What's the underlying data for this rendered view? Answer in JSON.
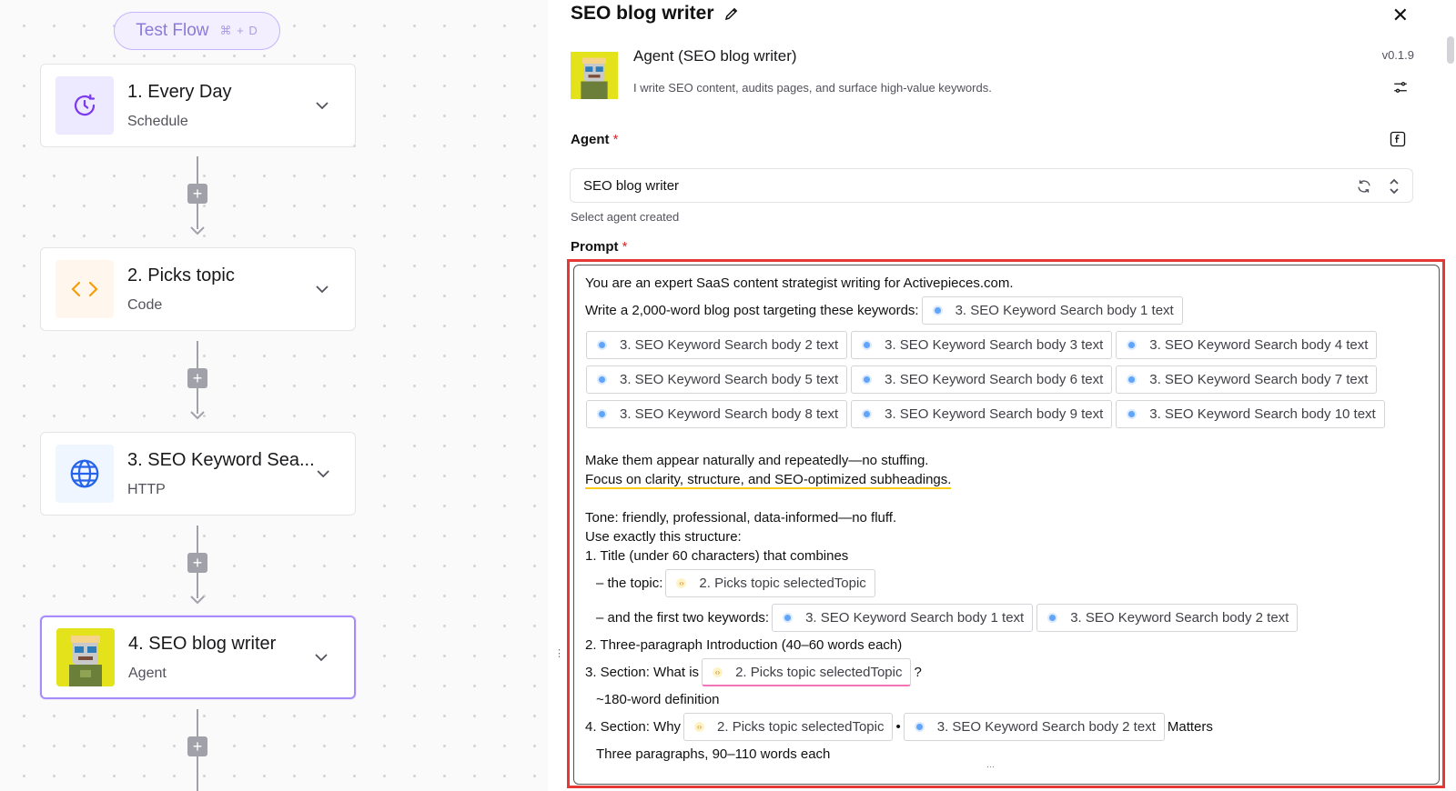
{
  "canvas": {
    "test_flow": {
      "label": "Test Flow",
      "shortcut": "⌘ + D"
    },
    "steps": [
      {
        "title": "1. Every Day",
        "subtitle": "Schedule",
        "icon": "clock-icon"
      },
      {
        "title": "2. Picks topic",
        "subtitle": "Code",
        "icon": "code-icon"
      },
      {
        "title": "3. SEO Keyword Sea...",
        "subtitle": "HTTP",
        "icon": "globe-icon"
      },
      {
        "title": "4. SEO blog writer",
        "subtitle": "Agent",
        "icon": "robot-avatar-icon"
      }
    ]
  },
  "panel": {
    "title": "SEO blog writer",
    "agent_name": "Agent (SEO blog writer)",
    "agent_desc": "I write SEO content, audits pages, and surface high-value keywords.",
    "version": "v0.1.9",
    "agent_label": "Agent",
    "required_mark": "*",
    "agent_value": "SEO blog writer",
    "agent_hint": "Select agent created",
    "prompt_label": "Prompt"
  },
  "prompt": {
    "line1": "You are an expert SaaS content strategist writing for Activepieces.com.",
    "line2": "Write a 2,000-word blog post targeting these keywords:",
    "kw": [
      "3. SEO Keyword Search body 1 text",
      "3. SEO Keyword Search body 2 text",
      "3. SEO Keyword Search body 3 text",
      "3. SEO Keyword Search body 4 text",
      "3. SEO Keyword Search body 5 text",
      "3. SEO Keyword Search body 6 text",
      "3. SEO Keyword Search body 7 text",
      "3. SEO Keyword Search body 8 text",
      "3. SEO Keyword Search body 9 text",
      "3. SEO Keyword Search body 10 text"
    ],
    "topic_pill": "2. Picks topic selectedTopic",
    "line3": "Make them appear naturally and repeatedly—no stuffing.",
    "line4": "Focus on clarity, structure, and SEO-optimized subheadings.",
    "line5": "Tone: friendly, professional, data-informed—no fluff.",
    "line6": "Use exactly this structure:",
    "line7": "1. Title (under 60 characters) that combines",
    "line8": "– the topic:",
    "line9": "– and the first two keywords:",
    "line10": "2. Three-paragraph Introduction (40–60 words each)",
    "line11": "3. Section: What is",
    "line11b": "?",
    "line12": "~180-word definition",
    "line13": "4. Section: Why",
    "line13b": "•",
    "line13c": "Matters",
    "line14": "Three paragraphs, 90–110 words each"
  },
  "colors": {
    "accent": "#a78bfa",
    "highlight": "#e53935"
  }
}
